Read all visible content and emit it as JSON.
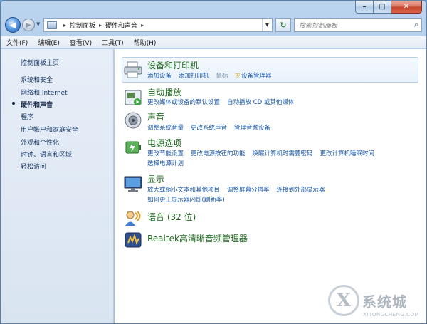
{
  "window": {
    "caption": {
      "minimize": "–",
      "maximize": "□",
      "close": "✕"
    }
  },
  "nav": {
    "back_icon": "back-arrow-icon",
    "forward_icon": "forward-arrow-icon",
    "address": {
      "crumbs": [
        "控制面板",
        "硬件和声音"
      ]
    },
    "search_placeholder": "搜索控制面板"
  },
  "menu": [
    "文件(F)",
    "编辑(E)",
    "查看(V)",
    "工具(T)",
    "帮助(H)"
  ],
  "sidebar": {
    "items": [
      {
        "label": "控制面板主页"
      },
      {
        "label": "系统和安全"
      },
      {
        "label": "网络和 Internet"
      },
      {
        "label": "硬件和声音",
        "active": true
      },
      {
        "label": "程序"
      },
      {
        "label": "用户帐户和家庭安全"
      },
      {
        "label": "外观和个性化"
      },
      {
        "label": "时钟、语言和区域"
      },
      {
        "label": "轻松访问"
      }
    ]
  },
  "categories": [
    {
      "title": "设备和打印机",
      "icon": "printer-icon",
      "links": [
        [
          "添加设备",
          "添加打印机",
          "鼠标",
          "设备管理器"
        ]
      ]
    },
    {
      "title": "自动播放",
      "icon": "autoplay-icon",
      "links": [
        [
          "更改媒体或设备的默认设置",
          "自动播放 CD 或其他媒体"
        ]
      ]
    },
    {
      "title": "声音",
      "icon": "speaker-icon",
      "links": [
        [
          "调整系统音量",
          "更改系统声音",
          "管理音频设备"
        ]
      ]
    },
    {
      "title": "电源选项",
      "icon": "power-icon",
      "links": [
        [
          "更改节能设置",
          "更改电源按钮的功能",
          "唤醒计算机时需要密码",
          "更改计算机睡眠时间"
        ],
        [
          "选择电源计划"
        ]
      ]
    },
    {
      "title": "显示",
      "icon": "display-icon",
      "links": [
        [
          "放大或缩小文本和其他项目",
          "调整屏幕分辨率",
          "连接到外部显示器"
        ],
        [
          "如何更正显示器闪烁(刷新率)"
        ]
      ]
    },
    {
      "title": "语音 (32 位)",
      "icon": "speech-icon",
      "links": []
    },
    {
      "title": "Realtek高清晰音频管理器",
      "icon": "realtek-icon",
      "links": []
    }
  ],
  "watermark": {
    "mark": "X",
    "text": "系统城",
    "sub": "XITONGCHENG.COM"
  }
}
